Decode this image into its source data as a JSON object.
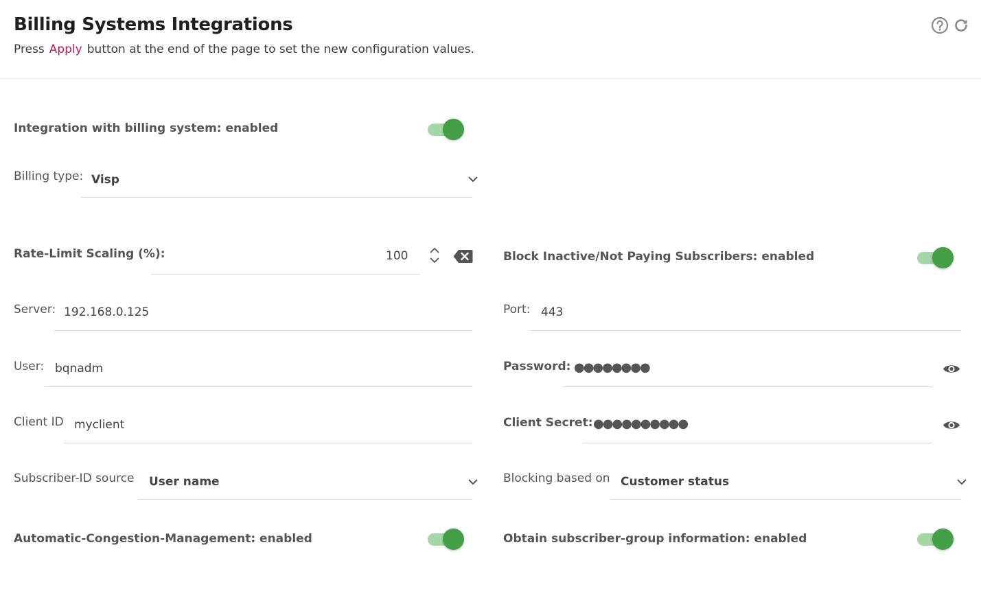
{
  "header": {
    "title": "Billing Systems Integrations",
    "subtitle_before": "Press",
    "subtitle_link": "Apply",
    "subtitle_after": "button at the end of the page to set the new configuration values.",
    "help_icon": "help-circle-icon",
    "refresh_icon": "refresh-icon"
  },
  "integration": {
    "label": "Integration with billing system: enabled",
    "enabled": true
  },
  "billing_type": {
    "label": "Billing type:",
    "value": "Visp"
  },
  "rate_limit": {
    "label": "Rate-Limit Scaling (%):",
    "value": "100"
  },
  "block_inactive": {
    "label": "Block Inactive/Not Paying Subscribers: enabled",
    "enabled": true
  },
  "server": {
    "label": "Server:",
    "value": "192.168.0.125"
  },
  "port": {
    "label": "Port:",
    "value": "443"
  },
  "user": {
    "label": "User:",
    "value": "bqnadm"
  },
  "password": {
    "label": "Password:",
    "masked": "●●●●●●●●"
  },
  "client_id": {
    "label": "Client ID",
    "value": "myclient"
  },
  "client_secret": {
    "label": "Client Secret:",
    "masked": "●●●●●●●●●●"
  },
  "subscriber_id_source": {
    "label": "Subscriber-ID source",
    "value": "User name"
  },
  "blocking_based_on": {
    "label": "Blocking based on",
    "value": "Customer status"
  },
  "acm": {
    "label": "Automatic-Congestion-Management: enabled",
    "enabled": true
  },
  "subscriber_group": {
    "label": "Obtain subscriber-group information: enabled",
    "enabled": true
  },
  "colors": {
    "accent_link": "#c2185b",
    "toggle_on": "#43a047",
    "toggle_track": "#a5d6a7"
  }
}
